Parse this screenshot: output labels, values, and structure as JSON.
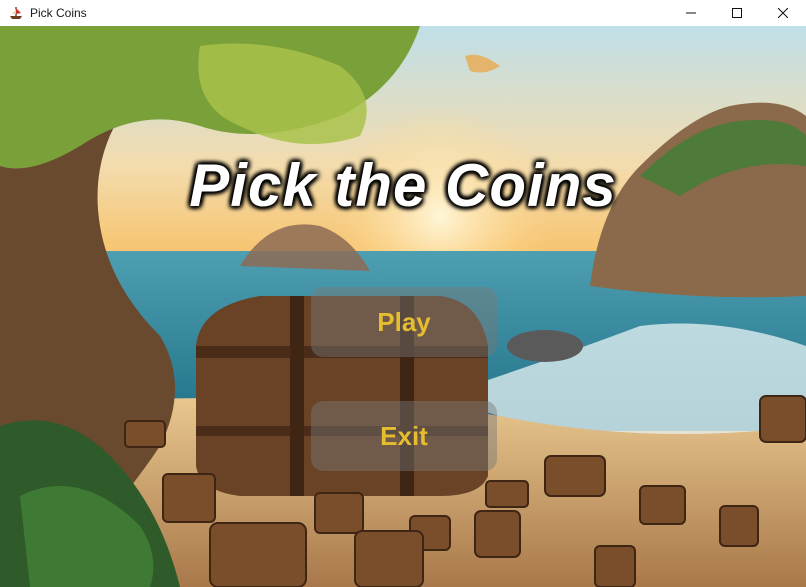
{
  "window": {
    "title": "Pick Coins",
    "app_icon": "pirate-ship-icon",
    "controls": [
      "minimize-icon",
      "maximize-icon",
      "close-icon"
    ]
  },
  "game": {
    "title": "Pick the Coins",
    "menu": {
      "play_label": "Play",
      "exit_label": "Exit"
    },
    "colors": {
      "button_text": "#e6bd2e",
      "title_text": "#ffffff"
    }
  }
}
